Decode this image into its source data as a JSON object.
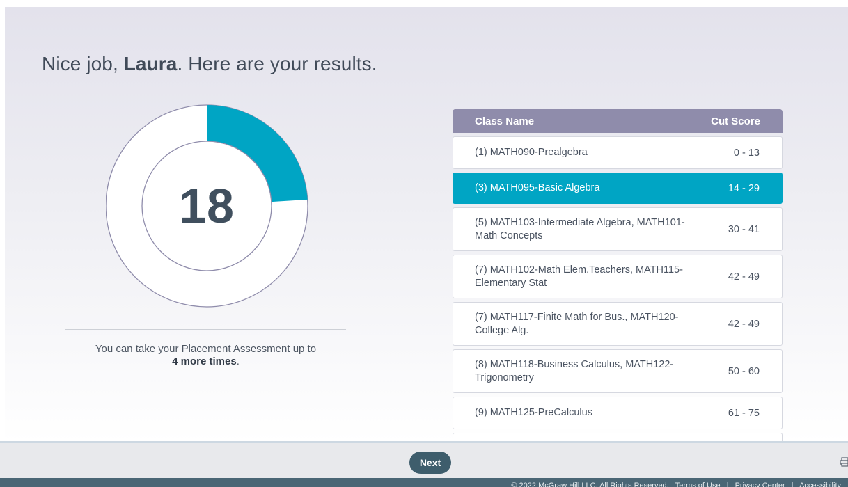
{
  "heading": {
    "prefix": "Nice job, ",
    "name": "Laura",
    "suffix": ". Here are your results."
  },
  "score": {
    "value": "18",
    "max": 75,
    "fill_fraction": 0.24,
    "fill_color": "#00a5c4",
    "ring_color": "#ffffff",
    "outline_color": "#8f8cab"
  },
  "attempts": {
    "line1": "You can take your Placement Assessment up to",
    "count_text": "4 more times",
    "period": "."
  },
  "table": {
    "headers": {
      "class_name": "Class Name",
      "cut_score": "Cut Score"
    },
    "rows": [
      {
        "class_name": "(1) MATH090-Prealgebra",
        "cut_score": "0 - 13",
        "selected": false
      },
      {
        "class_name": "(3) MATH095-Basic Algebra",
        "cut_score": "14 - 29",
        "selected": true
      },
      {
        "class_name": "(5) MATH103-Intermediate Algebra, MATH101-Math Concepts",
        "cut_score": "30 - 41",
        "selected": false
      },
      {
        "class_name": "(7) MATH102-Math Elem.Teachers, MATH115-Elementary Stat",
        "cut_score": "42 - 49",
        "selected": false
      },
      {
        "class_name": "(7) MATH117-Finite Math for Bus., MATH120-College Alg.",
        "cut_score": "42 - 49",
        "selected": false
      },
      {
        "class_name": "(8) MATH118-Business Calculus, MATH122-Trigonometry",
        "cut_score": "50 - 60",
        "selected": false
      },
      {
        "class_name": "(9) MATH125-PreCalculus",
        "cut_score": "61 - 75",
        "selected": false
      },
      {
        "class_name": "",
        "cut_score": "",
        "selected": false
      }
    ]
  },
  "bottom_bar": {
    "next_label": "Next",
    "print_icon": "printer-icon"
  },
  "footer": {
    "copyright": "© 2022 McGraw Hill LLC. All Rights Reserved.",
    "terms": "Terms of Use",
    "privacy": "Privacy Center",
    "accessibility": "Accessibility"
  }
}
